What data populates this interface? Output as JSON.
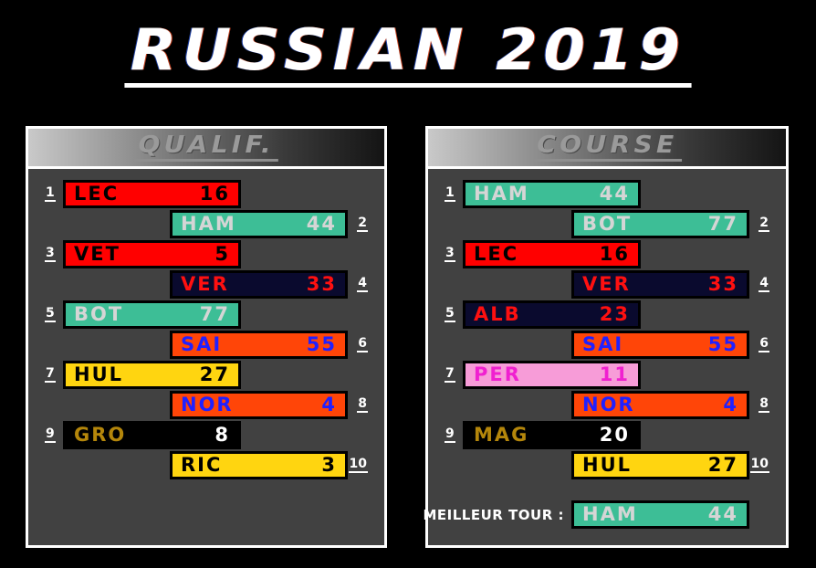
{
  "title": "RUSSIAN 2019",
  "teams": {
    "ferrari": {
      "bg": "#FF0000",
      "fg": "#000000"
    },
    "mercedes": {
      "bg": "#3DBE96",
      "fg": "#D5D5D5"
    },
    "redbull": {
      "bg": "#0A0A2E",
      "fg": "#FF1010"
    },
    "mclaren": {
      "bg": "#FF4508",
      "fg": "#2020FF"
    },
    "renault": {
      "bg": "#FFD510",
      "fg": "#000000"
    },
    "haas": {
      "bg": "#000000",
      "fg": "#B4860B",
      "fg_num": "#FFFFFF"
    },
    "racingpoint": {
      "bg": "#F79CD8",
      "fg": "#F020D0"
    }
  },
  "qualif": {
    "header": "QUALIF.",
    "rows": [
      {
        "pos": "1",
        "code": "LEC",
        "num": "16",
        "team": "ferrari",
        "side": "left"
      },
      {
        "pos": "2",
        "code": "HAM",
        "num": "44",
        "team": "mercedes",
        "side": "right"
      },
      {
        "pos": "3",
        "code": "VET",
        "num": "5",
        "team": "ferrari",
        "side": "left"
      },
      {
        "pos": "4",
        "code": "VER",
        "num": "33",
        "team": "redbull",
        "side": "right"
      },
      {
        "pos": "5",
        "code": "BOT",
        "num": "77",
        "team": "mercedes",
        "side": "left"
      },
      {
        "pos": "6",
        "code": "SAI",
        "num": "55",
        "team": "mclaren",
        "side": "right"
      },
      {
        "pos": "7",
        "code": "HUL",
        "num": "27",
        "team": "renault",
        "side": "left"
      },
      {
        "pos": "8",
        "code": "NOR",
        "num": "4",
        "team": "mclaren",
        "side": "right"
      },
      {
        "pos": "9",
        "code": "GRO",
        "num": "8",
        "team": "haas",
        "side": "left"
      },
      {
        "pos": "10",
        "code": "RIC",
        "num": "3",
        "team": "renault",
        "side": "right"
      }
    ]
  },
  "course": {
    "header": "COURSE",
    "rows": [
      {
        "pos": "1",
        "code": "HAM",
        "num": "44",
        "team": "mercedes",
        "side": "left"
      },
      {
        "pos": "2",
        "code": "BOT",
        "num": "77",
        "team": "mercedes",
        "side": "right"
      },
      {
        "pos": "3",
        "code": "LEC",
        "num": "16",
        "team": "ferrari",
        "side": "left"
      },
      {
        "pos": "4",
        "code": "VER",
        "num": "33",
        "team": "redbull",
        "side": "right"
      },
      {
        "pos": "5",
        "code": "ALB",
        "num": "23",
        "team": "redbull",
        "side": "left"
      },
      {
        "pos": "6",
        "code": "SAI",
        "num": "55",
        "team": "mclaren",
        "side": "right"
      },
      {
        "pos": "7",
        "code": "PER",
        "num": "11",
        "team": "racingpoint",
        "side": "left"
      },
      {
        "pos": "8",
        "code": "NOR",
        "num": "4",
        "team": "mclaren",
        "side": "right"
      },
      {
        "pos": "9",
        "code": "MAG",
        "num": "20",
        "team": "haas",
        "side": "left"
      },
      {
        "pos": "10",
        "code": "HUL",
        "num": "27",
        "team": "renault",
        "side": "right"
      }
    ],
    "fastest_lap": {
      "label": "MEILLEUR TOUR :",
      "code": "HAM",
      "num": "44",
      "team": "mercedes"
    }
  }
}
